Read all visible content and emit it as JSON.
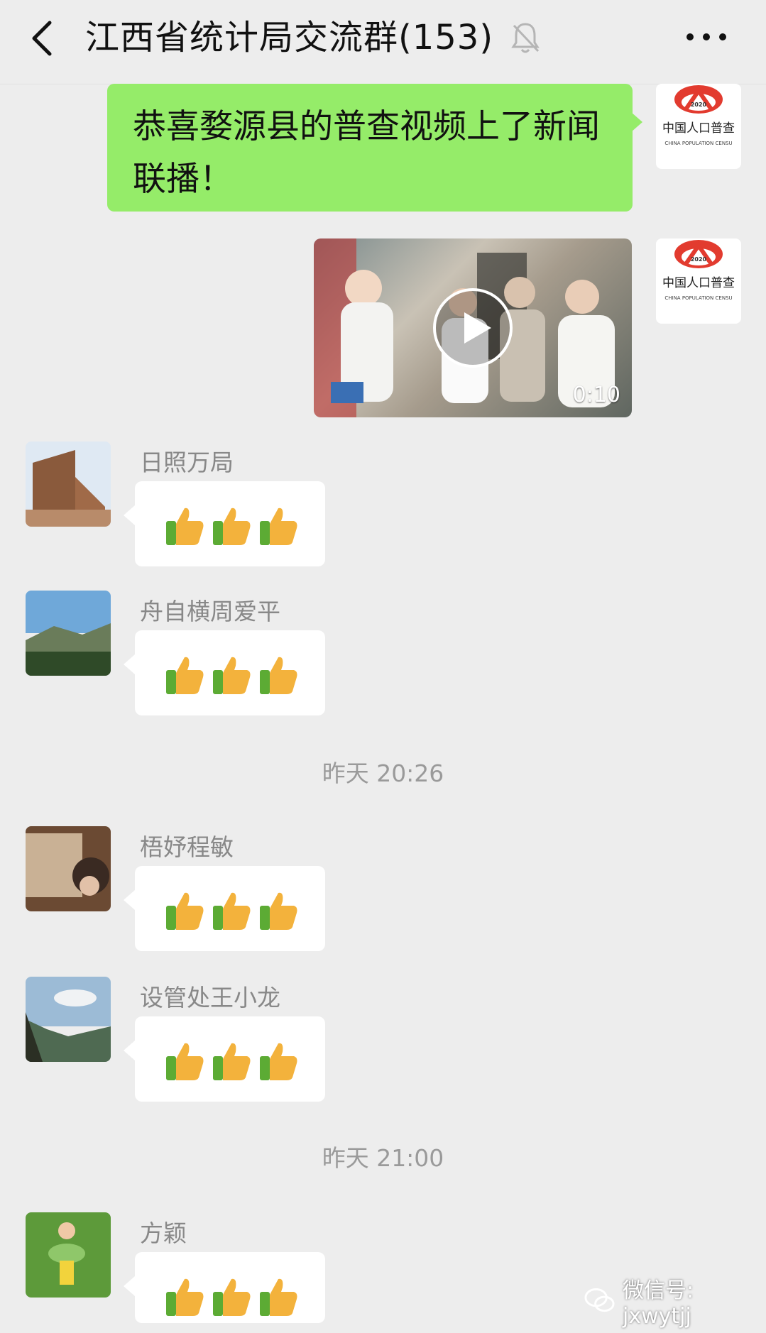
{
  "header": {
    "title": "江西省统计局交流群(153)",
    "back_icon": "chevron-left-icon",
    "mute_icon": "bell-off-icon",
    "more_icon": "more-dots-icon"
  },
  "outgoing": {
    "text": "恭喜婺源县的普查视频上了新闻联播！",
    "logo_text": "中国人口普查",
    "logo_subtext": "CHINA POPULATION CENSU",
    "logo_year": "2020",
    "video": {
      "duration": "0:10"
    }
  },
  "messages": [
    {
      "sender": "日照万局",
      "content": "👍👍👍"
    },
    {
      "sender": "舟自横周爱平",
      "content": "👍👍👍"
    },
    {
      "sender": "梧妤程敏",
      "content": "👍👍👍"
    },
    {
      "sender": "设管处王小龙",
      "content": "👍👍👍"
    },
    {
      "sender": "方颖",
      "content": "👍👍👍"
    }
  ],
  "timestamps": [
    "昨天 20:26",
    "昨天 21:00"
  ],
  "watermark": "微信号: jxwytjj",
  "colors": {
    "background": "#ededed",
    "outgoing_bubble": "#95ec69",
    "incoming_bubble": "#ffffff"
  }
}
